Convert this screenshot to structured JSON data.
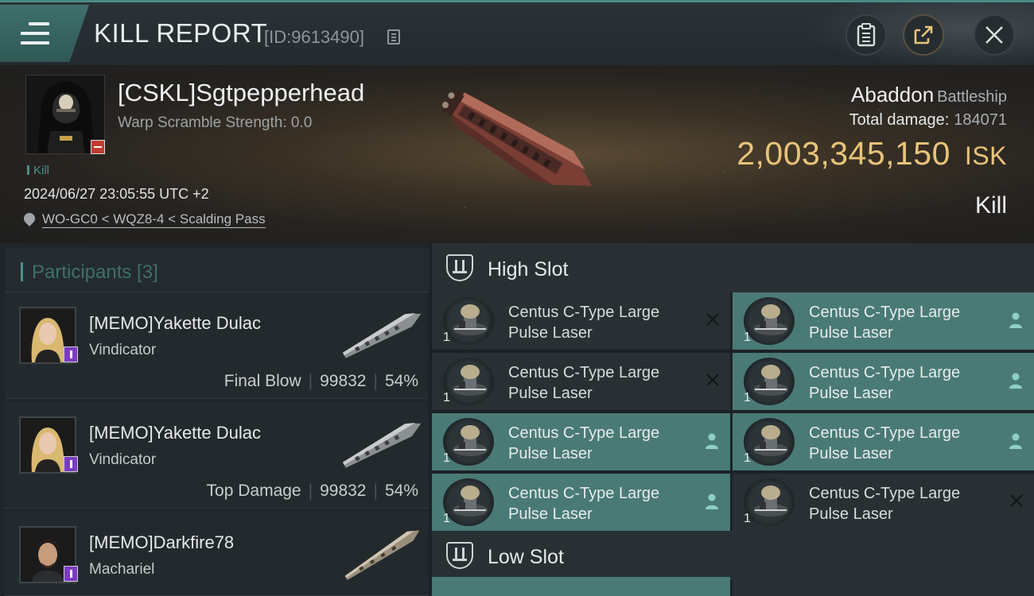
{
  "header": {
    "title": "KILL REPORT",
    "report_id": "[ID:9613490]",
    "menu_icon": "menu-icon",
    "buttons": [
      "clipboard-icon",
      "share-icon",
      "close-icon"
    ]
  },
  "victim": {
    "name": "[CSKL]Sgtpepperhead",
    "warp_scramble": "Warp Scramble Strength: 0.0",
    "kill_tag": "Kill",
    "datetime": "2024/06/27 23:05:55 UTC +2",
    "location": "WO-GC0 < WQZ8-4 < Scalding Pass",
    "ship_name": "Abaddon",
    "ship_class": "Battleship",
    "total_damage_label": "Total damage:",
    "total_damage_value": "184071",
    "isk_value": "2,003,345,150",
    "isk_unit": "ISK",
    "result_label": "Kill"
  },
  "participants": {
    "header": "Participants [3]",
    "rows": [
      {
        "name": "[MEMO]Yakette Dulac",
        "ship": "Vindicator",
        "role": "Final Blow",
        "damage": "99832",
        "percent": "54%"
      },
      {
        "name": "[MEMO]Yakette Dulac",
        "ship": "Vindicator",
        "role": "Top Damage",
        "damage": "99832",
        "percent": "54%"
      },
      {
        "name": "[MEMO]Darkfire78",
        "ship": "Machariel",
        "role": "",
        "damage": "",
        "percent": ""
      }
    ]
  },
  "fitting": {
    "high_slot_label": "High Slot",
    "low_slot_label": "Low Slot",
    "high_slot_items": [
      {
        "name_line1": "Centus C-Type Large",
        "name_line2": "Pulse Laser",
        "qty": "1",
        "status": "destroyed"
      },
      {
        "name_line1": "Centus C-Type Large",
        "name_line2": "Pulse Laser",
        "qty": "1",
        "status": "dropped"
      },
      {
        "name_line1": "Centus C-Type Large",
        "name_line2": "Pulse Laser",
        "qty": "1",
        "status": "destroyed"
      },
      {
        "name_line1": "Centus C-Type Large",
        "name_line2": "Pulse Laser",
        "qty": "1",
        "status": "dropped"
      },
      {
        "name_line1": "Centus C-Type Large",
        "name_line2": "Pulse Laser",
        "qty": "1",
        "status": "dropped"
      },
      {
        "name_line1": "Centus C-Type Large",
        "name_line2": "Pulse Laser",
        "qty": "1",
        "status": "dropped"
      },
      {
        "name_line1": "Centus C-Type Large",
        "name_line2": "Pulse Laser",
        "qty": "1",
        "status": "dropped"
      },
      {
        "name_line1": "Centus C-Type Large",
        "name_line2": "Pulse Laser",
        "qty": "1",
        "status": "destroyed"
      }
    ]
  },
  "colors": {
    "accent_teal": "#4e8f8b",
    "isk_gold": "#e8c47a",
    "dropped_bg": "#4a7a75",
    "destroyed_bg": "#283034"
  }
}
